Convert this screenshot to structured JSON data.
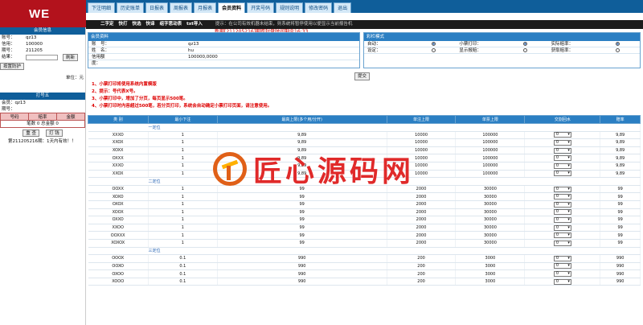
{
  "logo": "WE",
  "nav": [
    "下注明细",
    "历史账单",
    "日报表",
    "周报表",
    "月报表",
    "会员资料",
    "开奖号码",
    "规则说明",
    "修改密码",
    "退出"
  ],
  "notice": "新期[211205216]期距封盘时间剩余16:33",
  "subnav": {
    "items": [
      "二字定",
      "快打",
      "快选",
      "快译",
      "组字思动表",
      "txt导入"
    ],
    "tip": "提示：在公司有效机器未结束，则系统将暂停使用以便显示当前报告机"
  },
  "sidebar": {
    "head1": "会员信息",
    "info": [
      {
        "k": "账号：",
        "v": "qz13"
      },
      {
        "k": "信用：",
        "v": "100000"
      },
      {
        "k": "期号：",
        "v": "211205"
      }
    ],
    "result_label": "结果：",
    "refresh": "刷新",
    "print_btn": "按置防护",
    "unit": "单位：元",
    "head2": "打号五",
    "member_a": "会员：qz13",
    "member_b": "期号：",
    "cols": [
      "号码",
      "赔率",
      "金额"
    ],
    "count": "笔数 0 总金额 0",
    "btn_a": "重 查",
    "btn_b": "打 钱",
    "period": "第211205216期：1天内有效！！"
  },
  "panel1": {
    "head": "会员资料",
    "rows": [
      {
        "k": "账　号：",
        "v": "qz13"
      },
      {
        "k": "姓　名：",
        "v": "hu"
      },
      {
        "k": "信用额度：",
        "v": "100000,0000"
      }
    ]
  },
  "panel2": {
    "head": "彩栏模式",
    "rows": [
      [
        "自动：",
        "小票打印：",
        "实际赔率："
      ],
      [
        "设定：",
        "显示报赔：",
        "获取赔率："
      ]
    ]
  },
  "submit": "提交",
  "rules": [
    "1、小票打印将使用系统内置模版",
    "2、提示：号代表X号。",
    "3、小票打印中，增加了分页，每页显示500笔。",
    "4、小票打印时内容超过500笔，若分页打印，系统会自动确定小票打印页面，请注意使用。"
  ],
  "table": {
    "headers": [
      "类 别",
      "最小下注",
      "最高上限(多个用/分开)",
      "单注上限",
      "单票上限",
      "交割回水",
      "赔率"
    ],
    "sections": [
      {
        "name": "一定位",
        "rows": [
          [
            "XXXO",
            "1",
            "9,89",
            "10000",
            "100000",
            "0",
            "9,89"
          ],
          [
            "XXOX",
            "1",
            "9,89",
            "10000",
            "100000",
            "0",
            "9,89"
          ],
          [
            "XOXX",
            "1",
            "9,89",
            "10000",
            "100000",
            "0",
            "9,89"
          ],
          [
            "OXXX",
            "1",
            "9,89",
            "10000",
            "100000",
            "0",
            "9,89"
          ],
          [
            "XXXO",
            "1",
            "9,89",
            "10000",
            "100000",
            "0",
            "9,89"
          ],
          [
            "XXOX",
            "1",
            "9,89",
            "10000",
            "100000",
            "0",
            "9,89"
          ]
        ]
      },
      {
        "name": "二定位",
        "rows": [
          [
            "OOXX",
            "1",
            "99",
            "2000",
            "30000",
            "0",
            "99"
          ],
          [
            "XOXO",
            "1",
            "99",
            "2000",
            "30000",
            "0",
            "99"
          ],
          [
            "OXOX",
            "1",
            "99",
            "2000",
            "30000",
            "0",
            "99"
          ],
          [
            "XOOX",
            "1",
            "99",
            "2000",
            "30000",
            "0",
            "99"
          ],
          [
            "OXXO",
            "1",
            "99",
            "2000",
            "30000",
            "0",
            "99"
          ],
          [
            "XXOO",
            "1",
            "99",
            "2000",
            "30000",
            "0",
            "99"
          ],
          [
            "OOXXX",
            "1",
            "99",
            "2000",
            "30000",
            "0",
            "99"
          ],
          [
            "XOXOX",
            "1",
            "99",
            "2000",
            "30000",
            "0",
            "99"
          ]
        ]
      },
      {
        "name": "三定位",
        "rows": [
          [
            "OOOX",
            "0.1",
            "990",
            "200",
            "3000",
            "0",
            "990"
          ],
          [
            "OOXO",
            "0.1",
            "990",
            "200",
            "3000",
            "0",
            "990"
          ],
          [
            "OXOO",
            "0.1",
            "990",
            "200",
            "3000",
            "0",
            "990"
          ],
          [
            "XOOO",
            "0.1",
            "990",
            "200",
            "3000",
            "0",
            "990"
          ]
        ]
      }
    ]
  }
}
